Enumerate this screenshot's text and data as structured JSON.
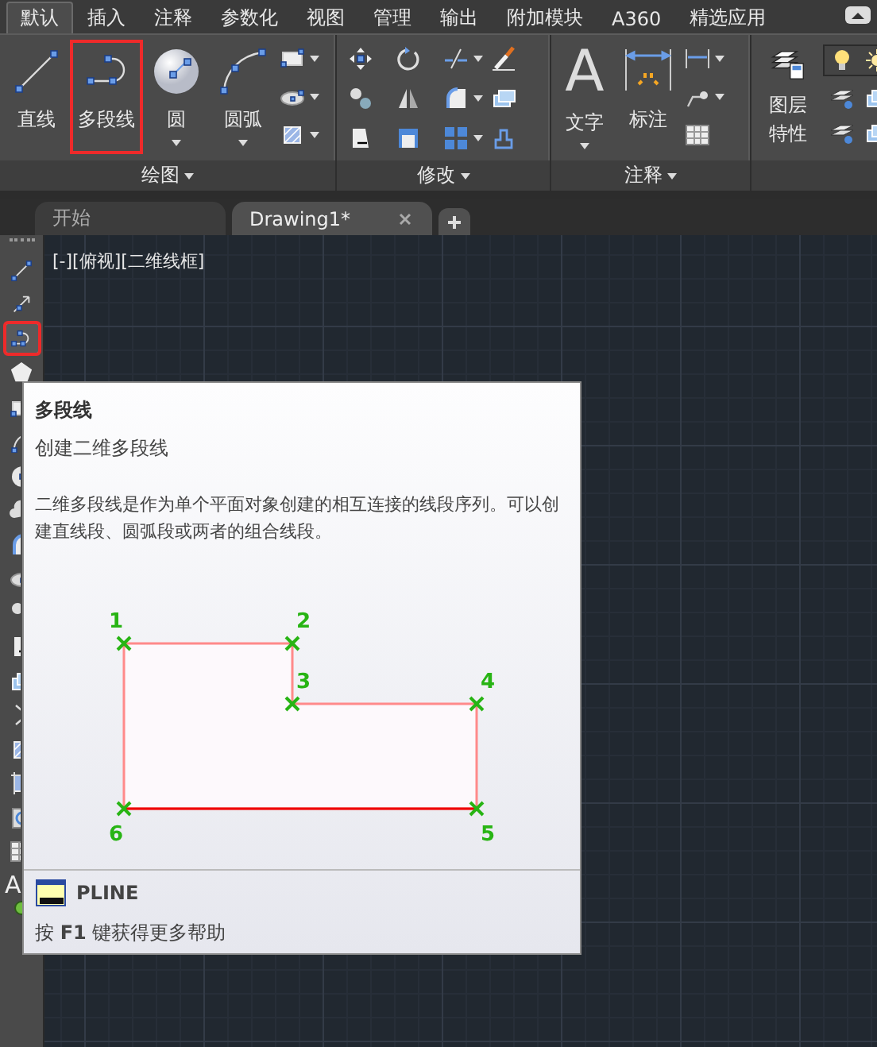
{
  "ribbon_tabs": [
    {
      "label": "默认",
      "selected": true
    },
    {
      "label": "插入",
      "selected": false
    },
    {
      "label": "注释",
      "selected": false
    },
    {
      "label": "参数化",
      "selected": false
    },
    {
      "label": "视图",
      "selected": false
    },
    {
      "label": "管理",
      "selected": false
    },
    {
      "label": "输出",
      "selected": false
    },
    {
      "label": "附加模块",
      "selected": false
    },
    {
      "label": "A360",
      "selected": false
    },
    {
      "label": "精选应用",
      "selected": false
    }
  ],
  "ribbon_panels": [
    {
      "kind": "draw",
      "title": "绘图",
      "tools": [
        {
          "label": "直线",
          "dropdown": false,
          "highlighted": false
        },
        {
          "label": "多段线",
          "dropdown": false,
          "highlighted": true
        },
        {
          "label": "圆",
          "dropdown": true,
          "highlighted": false
        },
        {
          "label": "圆弧",
          "dropdown": true,
          "highlighted": false
        }
      ]
    },
    {
      "kind": "modify",
      "title": "修改"
    },
    {
      "kind": "annotate",
      "title": "注释",
      "tools": [
        {
          "label": "文字",
          "glyph": "A",
          "dropdown": true,
          "highlighted": false
        },
        {
          "label": "标注",
          "dropdown": false,
          "highlighted": false
        }
      ]
    },
    {
      "kind": "layers",
      "tools": [
        {
          "label": "图层特性",
          "dropdown": false,
          "highlighted": false
        }
      ]
    }
  ],
  "file_tabs": [
    {
      "label": "开始",
      "selected": false
    },
    {
      "label": "Drawing1*",
      "selected": true
    }
  ],
  "viewport_label": "[-][俯视][二维线框]",
  "left_toolbar": {
    "tools": [
      {
        "highlighted": false
      },
      {
        "highlighted": false
      },
      {
        "highlighted": true
      },
      {
        "highlighted": false
      },
      {
        "highlighted": false
      },
      {
        "highlighted": false
      },
      {
        "highlighted": false
      },
      {
        "highlighted": false
      },
      {
        "highlighted": false
      },
      {
        "highlighted": false
      },
      {
        "highlighted": false
      },
      {
        "highlighted": false
      },
      {
        "highlighted": false
      },
      {
        "highlighted": false
      },
      {
        "highlighted": false
      },
      {
        "highlighted": false
      },
      {
        "highlighted": false
      },
      {
        "highlighted": false
      }
    ],
    "text_glyph": "A"
  },
  "tooltip": {
    "title": "多段线",
    "subtitle": "创建二维多段线",
    "description": "二维多段线是作为单个平面对象创建的相互连接的线段序列。可以创建直线段、圆弧段或两者的组合线段。",
    "diagram": {
      "point_labels": [
        "1",
        "2",
        "3",
        "4",
        "5",
        "6"
      ]
    },
    "command": "PLINE",
    "help": "按 **F1** 键获得更多帮助"
  }
}
